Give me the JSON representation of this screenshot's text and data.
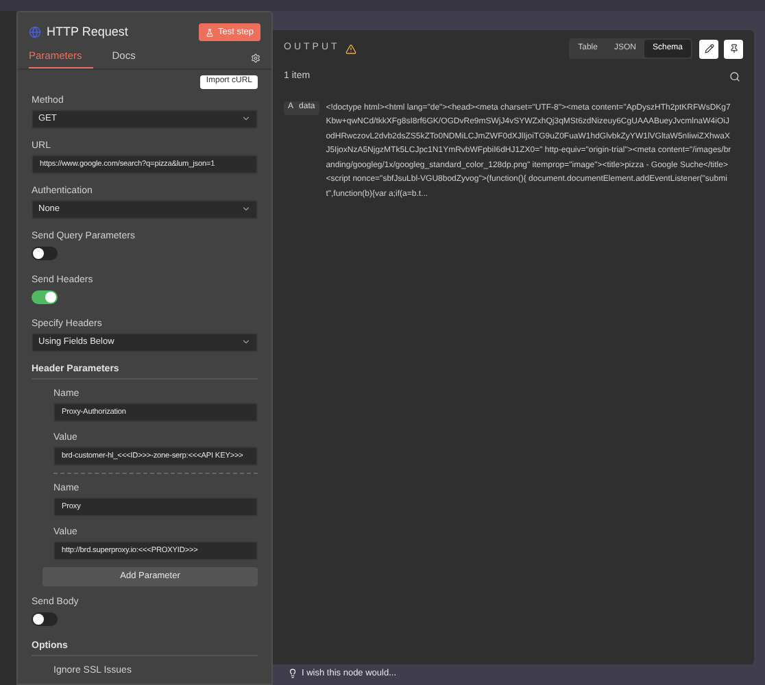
{
  "node": {
    "title": "HTTP Request",
    "test_button": "Test step",
    "tabs": [
      {
        "label": "Parameters",
        "selected": true
      },
      {
        "label": "Docs",
        "selected": false
      }
    ],
    "import_button": "Import cURL"
  },
  "parameters": [
    {
      "kind": "select",
      "label": "Method",
      "value": "GET"
    },
    {
      "kind": "input",
      "label": "URL",
      "value": "https://www.google.com/search?q=pizza&lum_json=1"
    },
    {
      "kind": "select",
      "label": "Authentication",
      "value": "None"
    },
    {
      "kind": "toggle",
      "label": "Send Query Parameters",
      "on": false
    },
    {
      "kind": "toggle",
      "label": "Send Headers",
      "on": true
    },
    {
      "kind": "select",
      "label": "Specify Headers",
      "value": "Using Fields Below"
    },
    {
      "kind": "section",
      "label": "Header Parameters"
    },
    {
      "kind": "headers",
      "entries": [
        {
          "name_label": "Name",
          "name": "Proxy-Authorization",
          "value_label": "Value",
          "value": "brd-customer-hl_<<<ID>>>-zone-serp:<<<API KEY>>>"
        },
        {
          "name_label": "Name",
          "name": "Proxy",
          "value_label": "Value",
          "value": "http://brd.superproxy.io:<<<PROXYID>>>"
        }
      ],
      "add_button": "Add Parameter"
    },
    {
      "kind": "toggle",
      "label": "Send Body",
      "on": false
    },
    {
      "kind": "section",
      "label": "Options"
    },
    {
      "kind": "option",
      "label": "Ignore SSL Issues"
    }
  ],
  "output": {
    "title": "OUTPUT",
    "views": [
      {
        "label": "Table",
        "selected": false
      },
      {
        "label": "JSON",
        "selected": false
      },
      {
        "label": "Schema",
        "selected": true
      }
    ],
    "count": "1 item",
    "field": {
      "type_glyph": "A",
      "name": "data",
      "value": "<!doctype html><html lang=\"de\"><head><meta charset=\"UTF-8\"><meta content=\"ApDyszHTh2ptKRFWsDKg7Kbw+qwNCd/tkkXFg8sI8rf6GK/OGDvRe9mSWjJ4vSYWZxhQj3qMSt6zdNizeuy6CgUAAABueyJvcmlnaW4iOiJodHRwczovL2dvb2dsZS5kZTo0NDMiLCJmZWF0dXJlIjoiTG9uZ0FuaW1hdGlvbkZyYW1lVGltaW5nIiwiZXhwaXJ5IjoxNzA5NjgzMTk5LCJpc1N1YmRvbWFpbiI6dHJ1ZX0=\" http-equiv=\"origin-trial\"><meta content=\"/images/branding/googleg/1x/googleg_standard_color_128dp.png\" itemprop=\"image\"><title>pizza - Google Suche</title><script nonce=\"sbfJsuLbl-VGU8bodZyvog\">(function(){ document.documentElement.addEventListener(\"submit\",function(b){var a;if(a=b.t..."
    }
  },
  "feedback": "I wish this node would..."
}
